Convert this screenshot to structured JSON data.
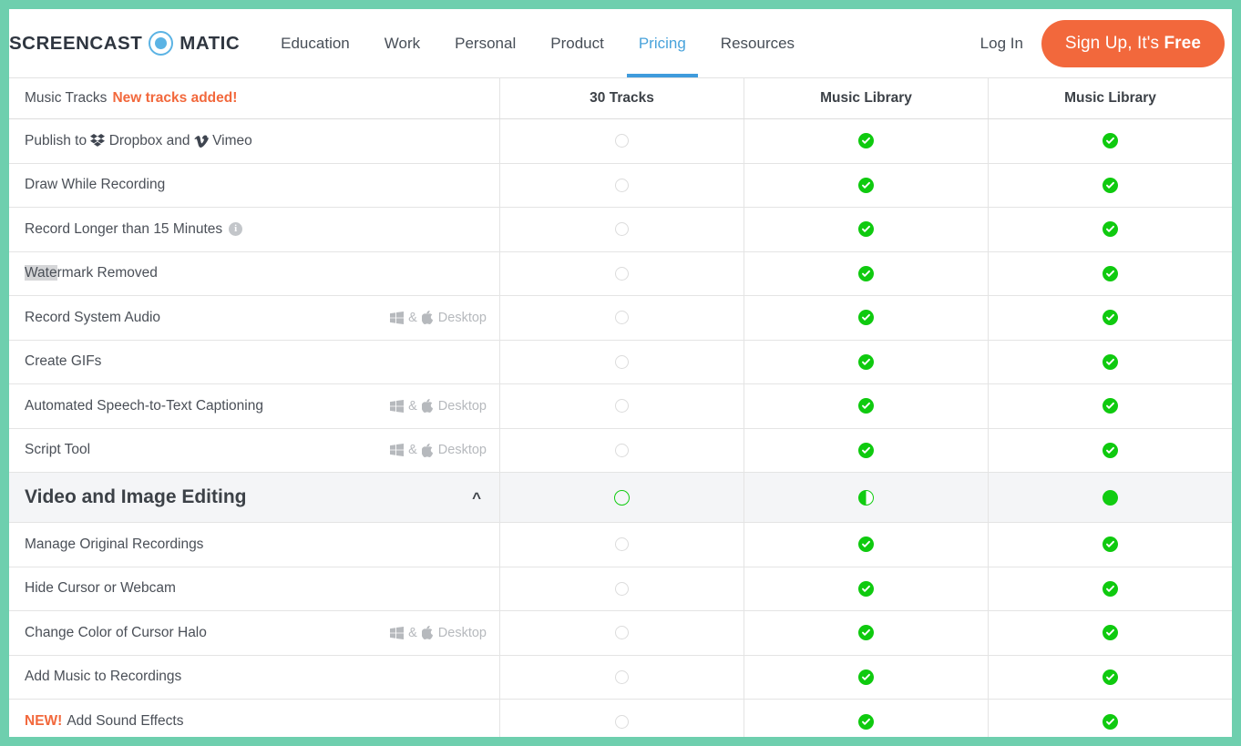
{
  "brand": {
    "logo_left": "SCREENCAST",
    "logo_right": "MATIC",
    "accent_blue": "#49a3db",
    "accent_orange": "#f2683c",
    "accent_green": "#11cc11",
    "frame_color": "#6ecfae",
    "logo_dot_icon": "record-dot-icon"
  },
  "nav": {
    "links": [
      {
        "label": "Education",
        "active": false
      },
      {
        "label": "Work",
        "active": false
      },
      {
        "label": "Personal",
        "active": false
      },
      {
        "label": "Product",
        "active": false
      },
      {
        "label": "Pricing",
        "active": true
      },
      {
        "label": "Resources",
        "active": false
      }
    ],
    "login_label": "Log In",
    "signup_label_plain": "Sign Up, It's ",
    "signup_label_bold": "Free"
  },
  "table": {
    "columns": [
      {
        "label": "30 Tracks"
      },
      {
        "label": "Music Library"
      },
      {
        "label": "Music Library"
      }
    ],
    "header_row": {
      "feature": "Music Tracks",
      "badge": "New tracks added!"
    },
    "rows": [
      {
        "type": "feature",
        "label": "Publish to ",
        "logos": [
          "dropbox-icon",
          "vimeo-icon"
        ],
        "label_mid": "Dropbox and ",
        "label_end": "Vimeo",
        "platform": null,
        "values": [
          "empty",
          "check",
          "check"
        ]
      },
      {
        "type": "feature",
        "label": "Draw While Recording",
        "platform": null,
        "values": [
          "empty",
          "check",
          "check"
        ]
      },
      {
        "type": "feature",
        "label": "Record Longer than 15 Minutes",
        "info": true,
        "platform": null,
        "values": [
          "empty",
          "check",
          "check"
        ]
      },
      {
        "type": "feature",
        "label": "Watermark Removed",
        "selected_prefix": "Wate",
        "platform": null,
        "values": [
          "empty",
          "check",
          "check"
        ]
      },
      {
        "type": "feature",
        "label": "Record System Audio",
        "platform": "Desktop",
        "values": [
          "empty",
          "check",
          "check"
        ]
      },
      {
        "type": "feature",
        "label": "Create GIFs",
        "platform": null,
        "values": [
          "empty",
          "check",
          "check"
        ]
      },
      {
        "type": "feature",
        "label": "Automated Speech-to-Text Captioning",
        "platform": "Desktop",
        "values": [
          "empty",
          "check",
          "check"
        ]
      },
      {
        "type": "feature",
        "label": "Script Tool",
        "platform": "Desktop",
        "values": [
          "empty",
          "check",
          "check"
        ]
      },
      {
        "type": "section",
        "label": "Video and Image Editing",
        "chevron": "chevron-up-icon",
        "values": [
          "ring",
          "half",
          "full"
        ]
      },
      {
        "type": "feature",
        "label": "Manage Original Recordings",
        "platform": null,
        "values": [
          "empty",
          "check",
          "check"
        ]
      },
      {
        "type": "feature",
        "label": "Hide Cursor or Webcam",
        "platform": null,
        "values": [
          "empty",
          "check",
          "check"
        ]
      },
      {
        "type": "feature",
        "label": "Change Color of Cursor Halo",
        "platform": "Desktop",
        "values": [
          "empty",
          "check",
          "check"
        ]
      },
      {
        "type": "feature",
        "label": "Add Music to Recordings",
        "platform": null,
        "values": [
          "empty",
          "check",
          "check"
        ]
      },
      {
        "type": "feature",
        "label": "Add Sound Effects",
        "badge_pre": "NEW!",
        "platform": null,
        "values": [
          "empty",
          "check",
          "check"
        ]
      }
    ],
    "platform_amp": "&",
    "info_glyph": "i"
  }
}
